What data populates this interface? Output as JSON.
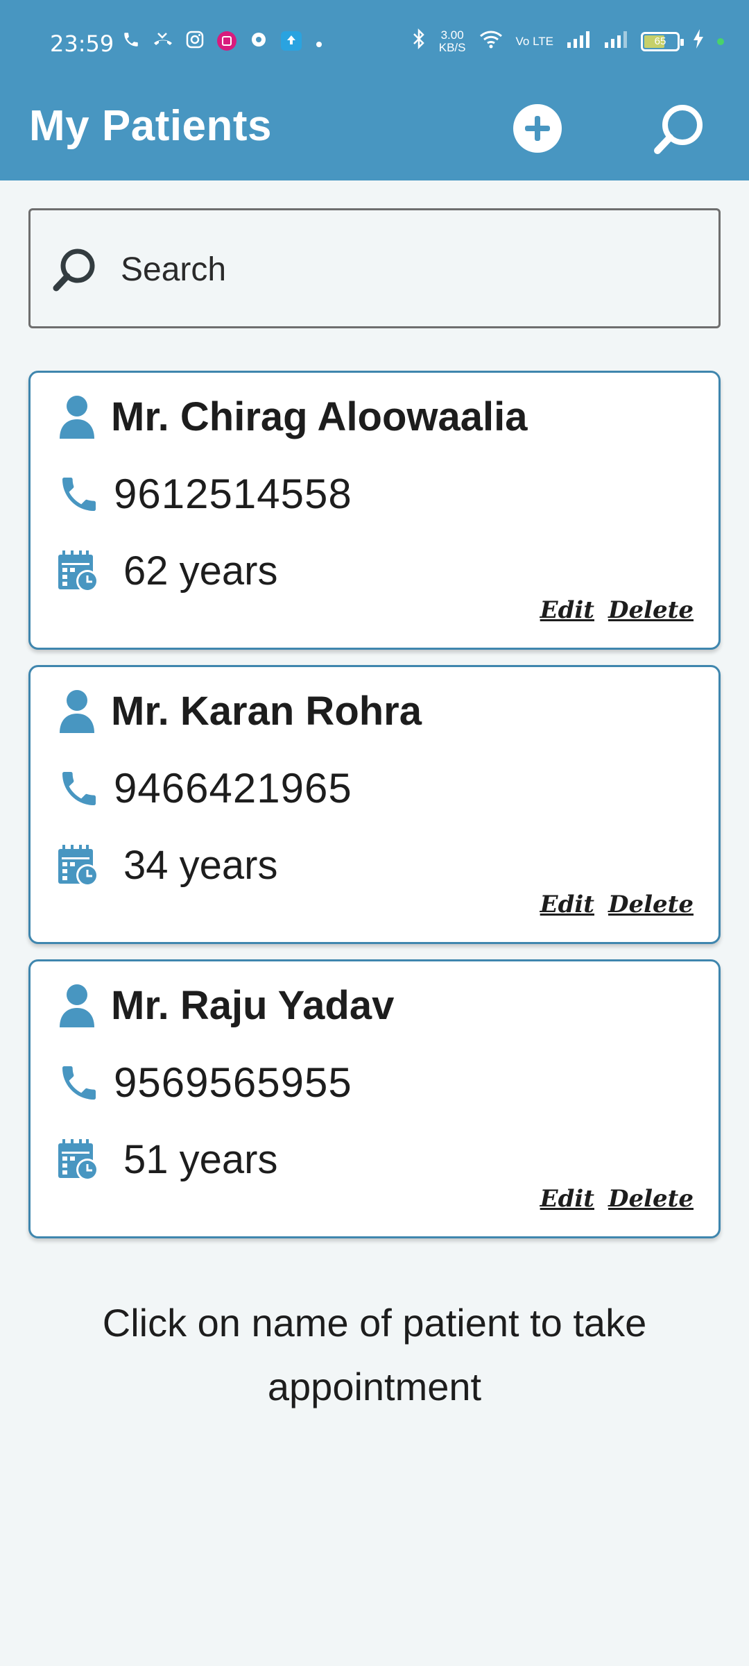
{
  "status_bar": {
    "time": "23:59",
    "net_speed_value": "3.00",
    "net_speed_unit": "KB/S",
    "network_label": "Vo LTE",
    "battery_level": "65"
  },
  "app_bar": {
    "title": "My Patients"
  },
  "search": {
    "placeholder": "Search"
  },
  "patients": [
    {
      "name": "Mr. Chirag Aloowaalia",
      "phone": "9612514558",
      "age": "62 years",
      "edit_label": "Edit",
      "delete_label": "Delete"
    },
    {
      "name": "Mr. Karan Rohra",
      "phone": "9466421965",
      "age": "34 years",
      "edit_label": "Edit",
      "delete_label": "Delete"
    },
    {
      "name": "Mr. Raju Yadav",
      "phone": "9569565955",
      "age": "51 years",
      "edit_label": "Edit",
      "delete_label": "Delete"
    }
  ],
  "footer": {
    "hint": "Click on name of patient to take appointment"
  },
  "colors": {
    "primary": "#4896c1",
    "card_border": "#3f86ae",
    "background": "#f2f6f7"
  }
}
